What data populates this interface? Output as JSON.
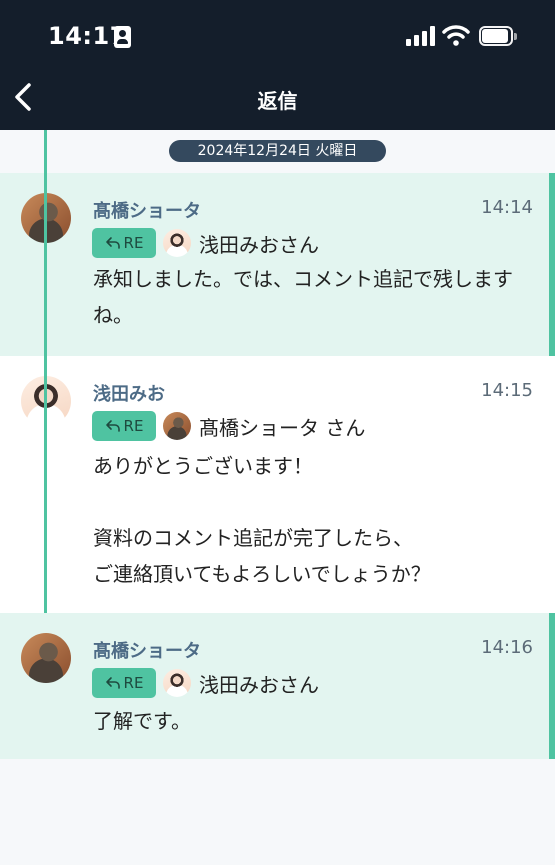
{
  "status_bar": {
    "time": "14:17"
  },
  "header": {
    "title": "返信"
  },
  "date_separator": "2024年12月24日 火曜日",
  "messages": [
    {
      "sender": "髙橋ショータ",
      "time": "14:14",
      "re_label": "RE",
      "reply_to": "浅田みおさん",
      "text": "承知しました。では、コメント追記で残しますね。"
    },
    {
      "sender": "浅田みお",
      "time": "14:15",
      "re_label": "RE",
      "reply_to": "髙橋ショータ さん",
      "text": "ありがとうございます！\n\n資料のコメント追記が完了したら、\nご連絡頂いてもよろしいでしょうか？"
    },
    {
      "sender": "髙橋ショータ",
      "time": "14:16",
      "re_label": "RE",
      "reply_to": "浅田みおさん",
      "text": "了解です。"
    }
  ],
  "colors": {
    "header_bg": "#141e2b",
    "accent": "#4fc3a1",
    "own_message_bg": "#e3f5f0",
    "sender_name": "#4d6b86"
  },
  "icons": [
    "id-card-icon",
    "signal-icon",
    "wifi-icon",
    "battery-icon",
    "back-chevron-icon",
    "reply-arrow-icon"
  ]
}
